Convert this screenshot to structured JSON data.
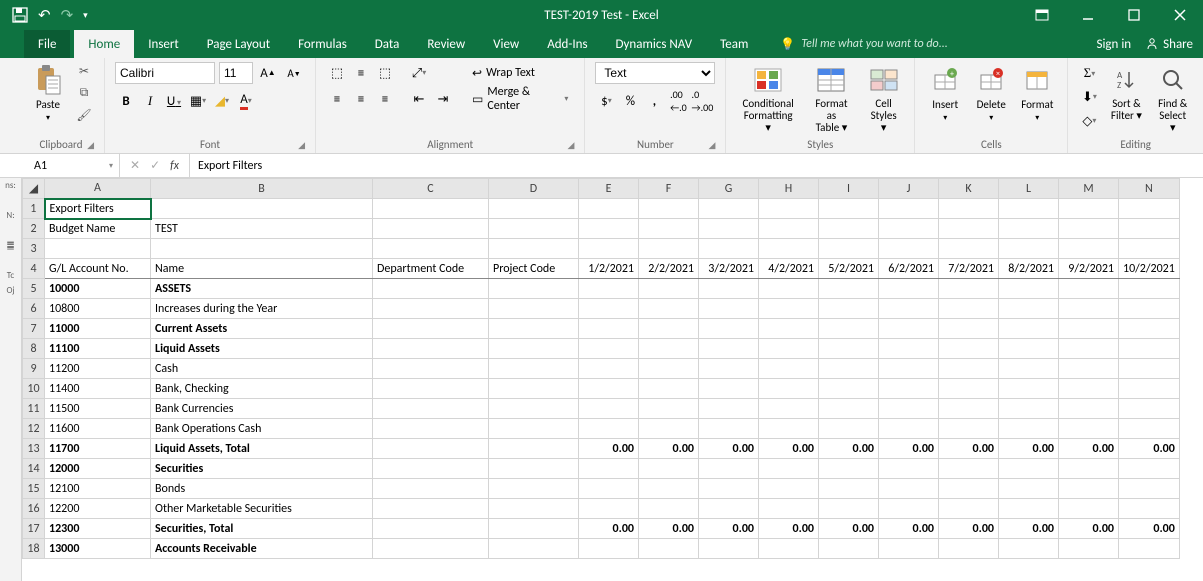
{
  "titlebar": {
    "title": "TEST-2019 Test - Excel"
  },
  "menubar": {
    "file": "File",
    "tabs": [
      "Home",
      "Insert",
      "Page Layout",
      "Formulas",
      "Data",
      "Review",
      "View",
      "Add-Ins",
      "Dynamics NAV",
      "Team"
    ],
    "active": "Home",
    "tellme": "Tell me what you want to do...",
    "signin": "Sign in",
    "share": "Share"
  },
  "ribbon": {
    "clipboard": {
      "paste": "Paste",
      "label": "Clipboard"
    },
    "font": {
      "name": "Calibri",
      "size": "11",
      "label": "Font"
    },
    "alignment": {
      "wrap": "Wrap Text",
      "merge": "Merge & Center",
      "label": "Alignment"
    },
    "number": {
      "format": "Text",
      "label": "Number"
    },
    "styles": {
      "cond": "Conditional Formatting",
      "table": "Format as Table",
      "cell": "Cell Styles",
      "label": "Styles"
    },
    "cells": {
      "insert": "Insert",
      "delete": "Delete",
      "format": "Format",
      "label": "Cells"
    },
    "editing": {
      "sort": "Sort & Filter",
      "find": "Find & Select",
      "label": "Editing"
    }
  },
  "formula": {
    "name": "A1",
    "content": "Export Filters",
    "fx": "fx"
  },
  "columns": [
    "A",
    "B",
    "C",
    "D",
    "E",
    "F",
    "G",
    "H",
    "I",
    "J",
    "K",
    "L",
    "M",
    "N"
  ],
  "dateHeaders": [
    "1/2/2021",
    "2/2/2021",
    "3/2/2021",
    "4/2/2021",
    "5/2/2021",
    "6/2/2021",
    "7/2/2021",
    "8/2/2021",
    "9/2/2021",
    "10/2/2021"
  ],
  "headerRow": {
    "a": "G/L Account No.",
    "b": "Name",
    "c": "Department Code",
    "d": "Project Code"
  },
  "rows": [
    {
      "n": 1,
      "a": "Export Filters",
      "b": "",
      "bold": false,
      "vals": null,
      "sel": true
    },
    {
      "n": 2,
      "a": "Budget Name",
      "b": "TEST",
      "bold": false,
      "vals": null
    },
    {
      "n": 3,
      "a": "",
      "b": "",
      "bold": false,
      "vals": null
    },
    {
      "n": 4,
      "header": true
    },
    {
      "n": 5,
      "a": "10000",
      "b": "ASSETS",
      "bold": true,
      "vals": null
    },
    {
      "n": 6,
      "a": "10800",
      "b": "Increases during the Year",
      "bold": false,
      "vals": null
    },
    {
      "n": 7,
      "a": "11000",
      "b": "Current Assets",
      "bold": true,
      "vals": null
    },
    {
      "n": 8,
      "a": "11100",
      "b": "Liquid Assets",
      "bold": true,
      "vals": null
    },
    {
      "n": 9,
      "a": "11200",
      "b": "Cash",
      "bold": false,
      "vals": null
    },
    {
      "n": 10,
      "a": "11400",
      "b": "Bank, Checking",
      "bold": false,
      "vals": null
    },
    {
      "n": 11,
      "a": "11500",
      "b": "Bank Currencies",
      "bold": false,
      "vals": null
    },
    {
      "n": 12,
      "a": "11600",
      "b": "Bank Operations Cash",
      "bold": false,
      "vals": null
    },
    {
      "n": 13,
      "a": "11700",
      "b": "Liquid Assets, Total",
      "bold": true,
      "vals": [
        "0.00",
        "0.00",
        "0.00",
        "0.00",
        "0.00",
        "0.00",
        "0.00",
        "0.00",
        "0.00",
        "0.00"
      ]
    },
    {
      "n": 14,
      "a": "12000",
      "b": "Securities",
      "bold": true,
      "vals": null
    },
    {
      "n": 15,
      "a": "12100",
      "b": "Bonds",
      "bold": false,
      "vals": null
    },
    {
      "n": 16,
      "a": "12200",
      "b": "Other Marketable Securities",
      "bold": false,
      "vals": null
    },
    {
      "n": 17,
      "a": "12300",
      "b": "Securities, Total",
      "bold": true,
      "vals": [
        "0.00",
        "0.00",
        "0.00",
        "0.00",
        "0.00",
        "0.00",
        "0.00",
        "0.00",
        "0.00",
        "0.00"
      ]
    },
    {
      "n": 18,
      "a": "13000",
      "b": "Accounts Receivable",
      "bold": true,
      "vals": null
    }
  ]
}
